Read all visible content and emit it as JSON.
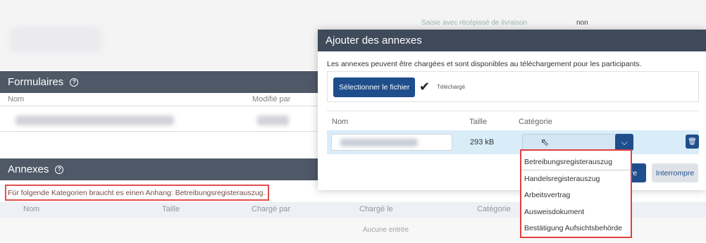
{
  "background": {
    "top_field_label": "Saisie avec récépissé de livraison",
    "top_field_value": "non",
    "forms_section": {
      "title": "Formulaires",
      "col_name": "Nom",
      "col_modified_by": "Modifié par"
    },
    "annexes_section": {
      "title": "Annexes",
      "hint": "Für folgende Kategorien braucht es einen Anhang: Betreibungsregisterauszug.",
      "columns": [
        "Nom",
        "Taille",
        "Chargé par",
        "Chargé le",
        "Catégorie"
      ],
      "empty_text": "Aucune entrée"
    }
  },
  "modal": {
    "title": "Ajouter des annexes",
    "description": "Les annexes peuvent être chargées et sont disponibles au téléchargement pour les participants.",
    "select_file_label": "Sélectionner le fichier",
    "uploaded_label": "Téléchargé",
    "table": {
      "col_name": "Nom",
      "col_size": "Taille",
      "col_category": "Catégorie",
      "row": {
        "size": "293 kB"
      }
    },
    "ok_label": "dre",
    "cancel_label": "Interrompre"
  },
  "category_dropdown": {
    "options": [
      "Betreibungsregisterauszug",
      "Handelsregisterauszug",
      "Arbeitsvertrag",
      "Ausweisdokument",
      "Bestätigung Aufsichtsbehörde"
    ]
  },
  "colors": {
    "header_bg": "#3f4a5a",
    "primary": "#1f4e8c",
    "highlight_border": "#e0413f",
    "selected_row": "#d9edf9"
  }
}
